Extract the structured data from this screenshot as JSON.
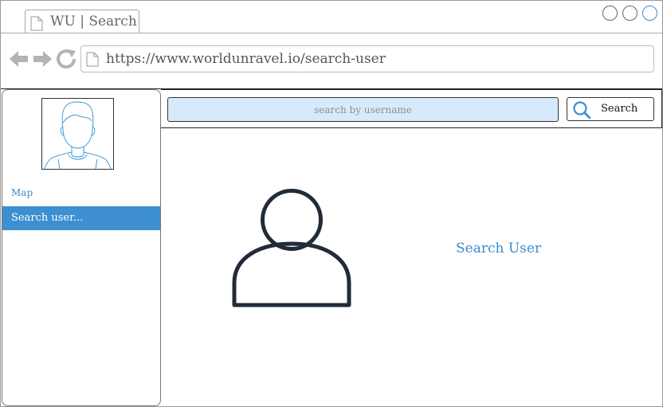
{
  "browser": {
    "tab_title": "WU | Search",
    "url": "https://www.worldunravel.io/search-user"
  },
  "sidebar": {
    "items": [
      {
        "label": "Map",
        "active": false
      },
      {
        "label": "Search user...",
        "active": true
      }
    ]
  },
  "search": {
    "placeholder": "search by username",
    "value": "",
    "button_label": "Search"
  },
  "main": {
    "title": "Search User"
  },
  "icons": {
    "tab": "document-icon",
    "back": "arrow-left-icon",
    "forward": "arrow-right-icon",
    "reload": "reload-icon",
    "search": "magnifier-icon",
    "profile": "user-avatar-icon",
    "placeholder": "user-silhouette-icon"
  },
  "colors": {
    "accent": "#3d8fd1",
    "link": "#3b8bcf",
    "input_bg": "#d6eafc",
    "icon_dark": "#222b38"
  }
}
